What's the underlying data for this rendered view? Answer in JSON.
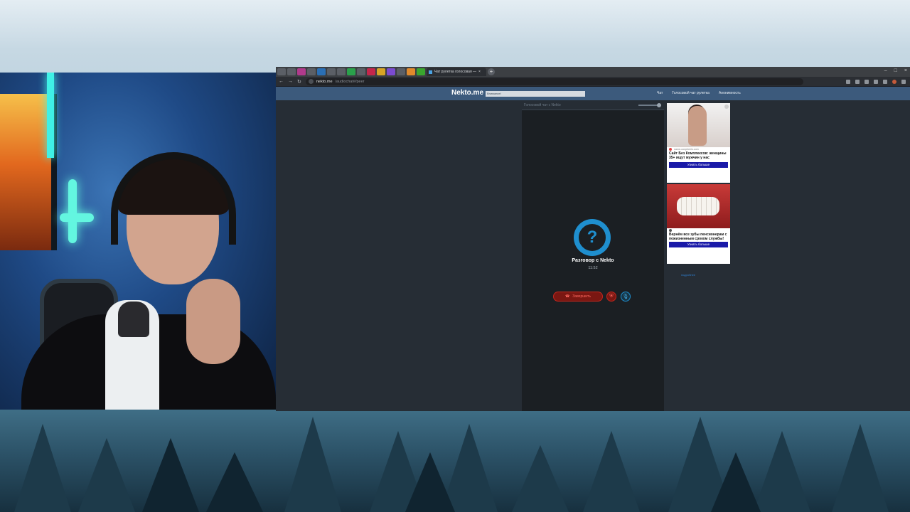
{
  "browser": {
    "tab_title": "Чат рулетка голосовая —",
    "url_host": "nekto.me",
    "url_path": "/audiochat#/peer"
  },
  "site": {
    "logo": "Nekto.me",
    "banner": "Внимание!",
    "nav": [
      "Чат",
      "Голосовой чат рулетка",
      "Анонимность"
    ]
  },
  "chat": {
    "title": "Голосовой чат с Nekto",
    "avatar_symbol": "?",
    "conversation_title": "Разговор с Nekto",
    "timer": "11:52",
    "end_button_label": "Завершить"
  },
  "ads": [
    {
      "source": "name-oonpheeis.com",
      "title": "Сайт Без Комплексов: женщины 35+ ищут мужчин у нас",
      "cta": "Узнать больше"
    },
    {
      "source": "",
      "title": "Вернём все зубы пенсионерам с пожизненным сроком службы!",
      "cta": "Узнать больше"
    }
  ],
  "ad_footer": {
    "link": "подробнее"
  },
  "colors": {
    "site_header": "#3c5a7c",
    "accent_blue": "#1f8fcf",
    "end_red": "#c5261d"
  }
}
